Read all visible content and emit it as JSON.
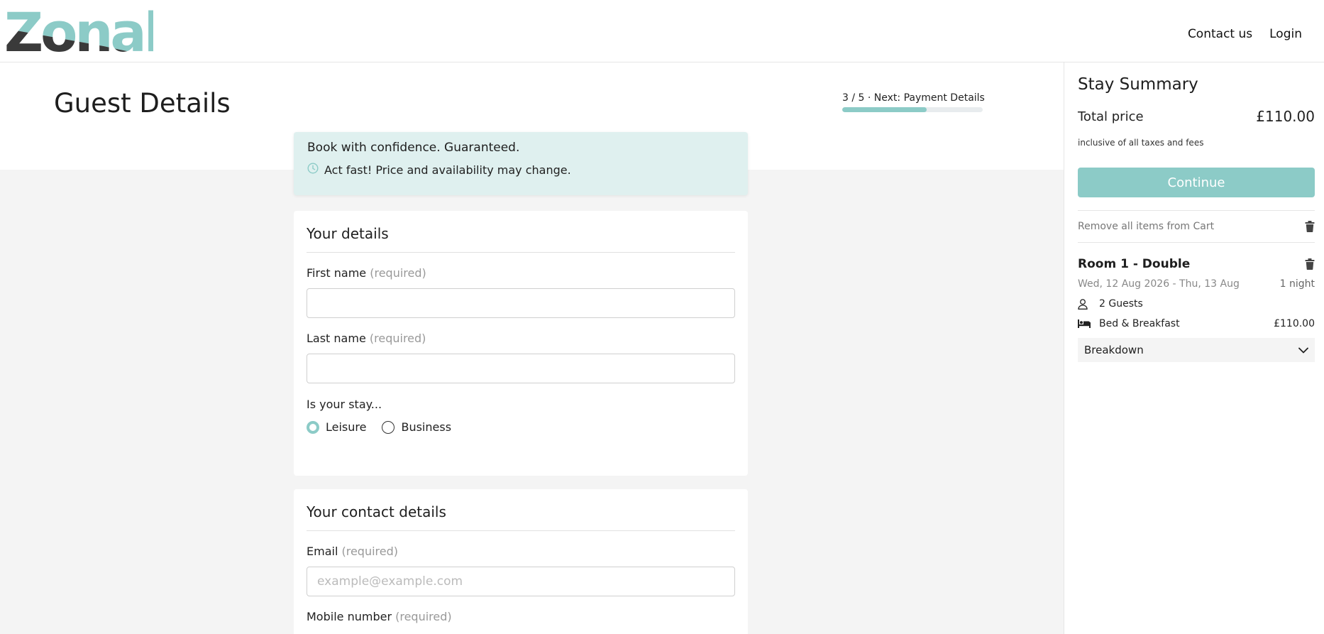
{
  "header": {
    "logo_text": "Zonal",
    "nav": {
      "contact": "Contact us",
      "login": "Login"
    }
  },
  "page": {
    "title": "Guest Details",
    "progress": {
      "text": "3 / 5 · Next: Payment Details",
      "fraction": 0.6
    }
  },
  "notice": {
    "title": "Book with confidence. Guaranteed.",
    "line": "Act fast! Price and availability may change."
  },
  "details_card": {
    "title": "Your details",
    "first_name_label": "First name",
    "last_name_label": "Last name",
    "required": "(required)",
    "stay_question": "Is your stay...",
    "options": {
      "leisure": "Leisure",
      "business": "Business"
    },
    "selected": "Leisure"
  },
  "contact_card": {
    "title": "Your contact details",
    "email_label": "Email",
    "email_placeholder": "example@example.com",
    "mobile_label": "Mobile number",
    "required": "(required)"
  },
  "summary": {
    "title": "Stay Summary",
    "total_label": "Total price",
    "total_value": "£110.00",
    "tax_note": "inclusive of all taxes and fees",
    "continue_label": "Continue",
    "remove_all": "Remove all items from Cart",
    "room": {
      "title": "Room 1 - Double",
      "dates": "Wed, 12 Aug 2026 - Thu, 13 Aug",
      "nights": "1 night",
      "guests": "2 Guests",
      "board": "Bed & Breakfast",
      "board_price": "£110.00",
      "breakdown_label": "Breakdown"
    }
  },
  "colors": {
    "accent": "#8ccbc7",
    "logo_dark": "#3a3a3a",
    "notice_bg": "#dff0ef"
  },
  "icons": [
    "clock-icon",
    "trash-icon",
    "person-icon",
    "bed-icon",
    "chevron-down-icon"
  ]
}
